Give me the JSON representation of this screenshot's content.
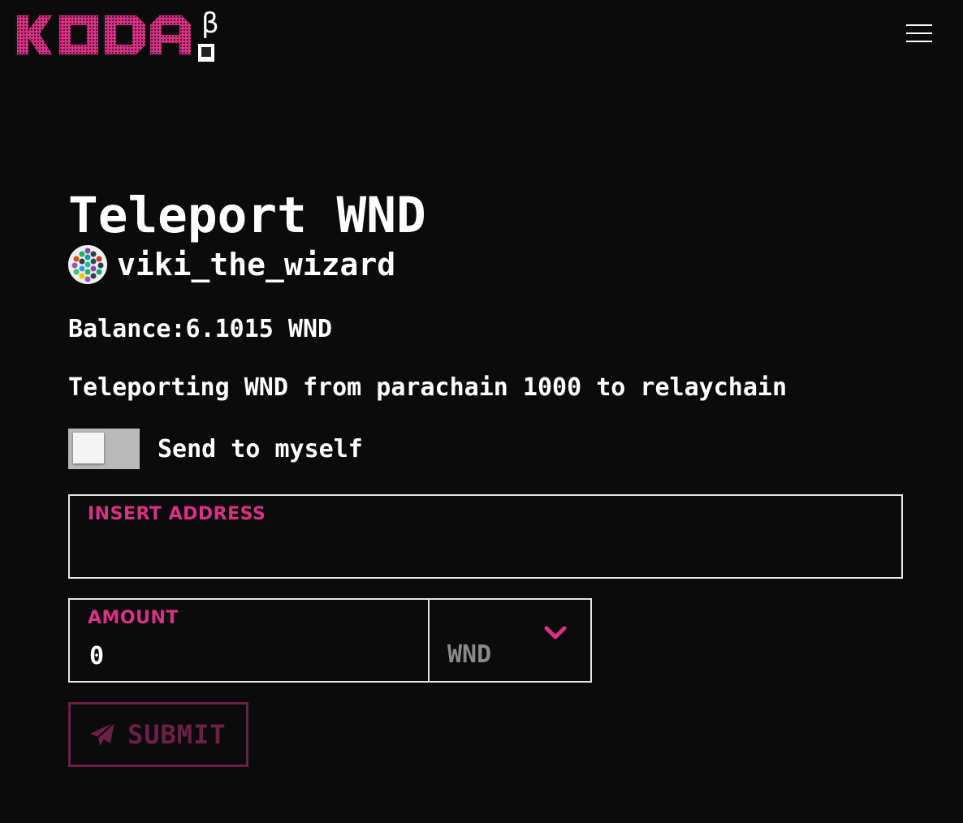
{
  "header": {
    "logo_text": "KODA",
    "logo_badge": "β",
    "menu_icon": "hamburger-menu-icon"
  },
  "main": {
    "title": "Teleport WND",
    "account": {
      "name": "viki_the_wizard",
      "avatar_icon": "identicon-avatar"
    },
    "balance": "Balance:6.1015 WND",
    "teleport_info": "Teleporting WND from parachain 1000 to relaychain",
    "send_to_myself": {
      "label": "Send to myself",
      "checked": false
    },
    "address_field": {
      "label": "INSERT ADDRESS",
      "value": ""
    },
    "amount_field": {
      "label": "AMOUNT",
      "value": "0"
    },
    "currency_select": {
      "selected": "WND",
      "icon": "chevron-down-icon"
    },
    "submit": {
      "label": "SUBMIT",
      "icon": "paper-plane-icon"
    }
  },
  "colors": {
    "accent": "#d63384",
    "submit_disabled": "#6e1f47",
    "background": "#0b0b0c",
    "toggle_track": "#b9b9b9"
  }
}
